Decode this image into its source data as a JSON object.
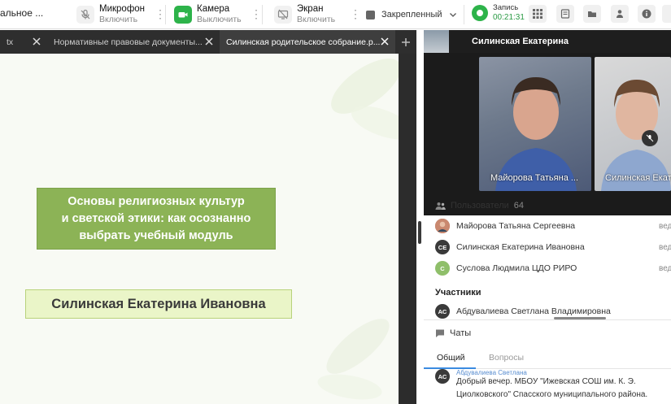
{
  "toolbar": {
    "title": "альное ...",
    "mic": {
      "label": "Микрофон",
      "status": "Включить"
    },
    "camera": {
      "label": "Камера",
      "status": "Выключить"
    },
    "screen": {
      "label": "Экран",
      "status": "Включить"
    },
    "pin_label": "Закрепленный",
    "record": {
      "label": "Запись",
      "time": "00:21:31"
    }
  },
  "tabs": [
    {
      "label": "tx",
      "active": false
    },
    {
      "label": "Нормативные правовые документы...",
      "active": false
    },
    {
      "label": "Силинская родительское собрание.p...",
      "active": true
    }
  ],
  "slide": {
    "title": "Основы религиозных культур\nи светской этики: как осознанно\nвыбрать учебный модуль",
    "author": "Силинская Екатерина Ивановна"
  },
  "speaker": {
    "name": "Силинская Екатерина"
  },
  "videos": [
    {
      "name": "Майорова Татьяна ..."
    },
    {
      "name": "Силинская Екате"
    }
  ],
  "users": {
    "title": "Пользователи",
    "count": "64",
    "list": [
      {
        "name": "Майорова Татьяна Сергеевна",
        "initials": "",
        "role": "вед",
        "color": "#b05a4a"
      },
      {
        "name": "Силинская Екатерина Ивановна",
        "initials": "СЕ",
        "role": "вед",
        "color": "#3a3a3a"
      },
      {
        "name": "Суслова Людмила ЦДО РИРО",
        "initials": "С",
        "role": "вед",
        "color": "#8fbf6a"
      }
    ],
    "participants_title": "Участники",
    "participants": [
      {
        "name": "Абдувалиева Светлана Владимировна",
        "initials": "АС",
        "color": "#3a3a3a"
      }
    ]
  },
  "chats": {
    "title": "Чаты",
    "tabs": [
      "Общий",
      "Вопросы"
    ],
    "message": {
      "author": "Абдувалиева Светлана",
      "initials": "АС",
      "text": "Добрый вечер. МБОУ \"Ижевская СОШ им. К. Э. Циолковского\" Спасского муниципального района."
    }
  },
  "colors": {
    "accent_green": "#2db34a",
    "slide_title_bg": "#8cb356",
    "slide_name_bg": "#eaf5c8",
    "tab_active": "#3e3e3e"
  }
}
